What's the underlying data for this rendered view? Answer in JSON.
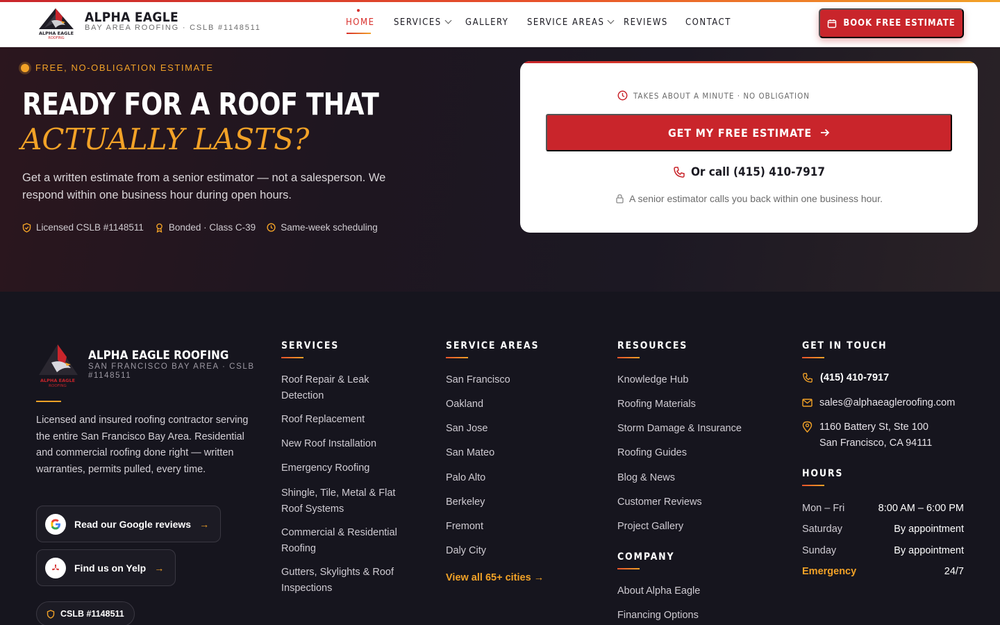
{
  "header": {
    "brand_title": "ALPHA EAGLE",
    "brand_subtitle": "BAY AREA ROOFING · CSLB #1148511",
    "logo_text_1": "ALPHA EAGLE",
    "logo_text_2": "ROOFING",
    "nav": [
      {
        "label": "HOME",
        "active": true
      },
      {
        "label": "SERVICES",
        "dropdown": true
      },
      {
        "label": "GALLERY"
      },
      {
        "label": "SERVICE AREAS",
        "dropdown": true
      },
      {
        "label": "REVIEWS"
      },
      {
        "label": "CONTACT"
      }
    ],
    "book_button": "BOOK FREE ESTIMATE"
  },
  "hero": {
    "eyebrow": "FREE, NO-OBLIGATION ESTIMATE",
    "heading": "READY FOR A ROOF THAT",
    "heading_accent": "ACTUALLY LASTS?",
    "lead": "Get a written estimate from a senior estimator — not a salesperson. We respond within one business hour during open hours.",
    "badges": [
      "Licensed CSLB #1148511",
      "Bonded · Class C-39",
      "Same-week scheduling"
    ]
  },
  "estimate_card": {
    "note": "TAKES ABOUT A MINUTE · NO OBLIGATION",
    "cta": "GET MY FREE ESTIMATE",
    "call": "Or call (415) 410-7917",
    "footnote": "A senior estimator calls you back within one business hour."
  },
  "footer": {
    "brand": "ALPHA EAGLE ROOFING",
    "brand_sub": "SAN FRANCISCO BAY AREA · CSLB #1148511",
    "about": "Licensed and insured roofing contractor serving the entire San Francisco Bay Area. Residential and commercial roofing done right — written warranties, permits pulled, every time.",
    "google_btn": "Read our Google reviews",
    "yelp_btn": "Find us on Yelp",
    "cslb_chip": "CSLB #1148511",
    "arrow": "→",
    "services": {
      "heading": "SERVICES",
      "items": [
        "Roof Repair & Leak Detection",
        "Roof Replacement",
        "New Roof Installation",
        "Emergency Roofing",
        "Shingle, Tile, Metal & Flat Roof Systems",
        "Commercial & Residential Roofing",
        "Gutters, Skylights & Roof Inspections"
      ]
    },
    "areas": {
      "heading": "SERVICE AREAS",
      "items": [
        "San Francisco",
        "Oakland",
        "San Jose",
        "San Mateo",
        "Palo Alto",
        "Berkeley",
        "Fremont",
        "Daly City"
      ],
      "view_all": "View all 65+ cities →"
    },
    "resources": {
      "heading": "RESOURCES",
      "items": [
        "Knowledge Hub",
        "Roofing Materials",
        "Storm Damage & Insurance",
        "Roofing Guides",
        "Blog & News",
        "Customer Reviews",
        "Project Gallery"
      ]
    },
    "company": {
      "heading": "COMPANY",
      "items": [
        "About Alpha Eagle",
        "Financing Options"
      ]
    },
    "contact": {
      "heading": "GET IN TOUCH",
      "phone": "(415) 410-7917",
      "email": "sales@alphaeagleroofing.com",
      "address_1": "1160 Battery St, Ste 100",
      "address_2": "San Francisco, CA 94111"
    },
    "hours": {
      "heading": "HOURS",
      "rows": [
        {
          "day": "Mon – Fri",
          "time": "8:00 AM – 6:00 PM"
        },
        {
          "day": "Saturday",
          "time": "By appointment"
        },
        {
          "day": "Sunday",
          "time": "By appointment"
        },
        {
          "day": "Emergency",
          "time": "24/7"
        }
      ]
    }
  },
  "colors": {
    "brand_red": "#c9252b",
    "accent_gold": "#f2a227",
    "footer_bg": "#16151e"
  }
}
